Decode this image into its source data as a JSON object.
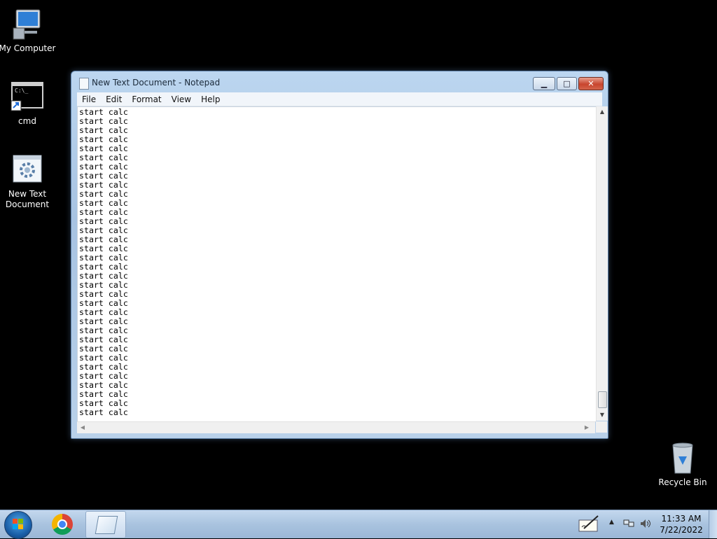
{
  "desktop": {
    "icons": [
      {
        "label": "My Computer",
        "icon": "computer-icon"
      },
      {
        "label": "cmd",
        "icon": "cmd-shortcut-icon"
      },
      {
        "label": "New Text Document",
        "icon": "batch-file-icon"
      },
      {
        "label": "Recycle Bin",
        "icon": "recycle-bin-icon"
      }
    ]
  },
  "window": {
    "title": "New Text Document - Notepad",
    "controls": {
      "minimize": "minimize-icon",
      "maximize": "maximize-icon",
      "close": "close-icon"
    },
    "menu": [
      "File",
      "Edit",
      "Format",
      "View",
      "Help"
    ],
    "line_text": "start calc",
    "visible_line_count": 34
  },
  "taskbar": {
    "start": "windows-start-icon",
    "pinned": [
      "chrome-icon",
      "notepad-icon"
    ],
    "tray_icons": [
      "pen-input-icon",
      "show-hidden-icons-arrow",
      "network-icon",
      "volume-icon"
    ],
    "clock": {
      "time": "11:33 AM",
      "date": "7/22/2022"
    }
  }
}
